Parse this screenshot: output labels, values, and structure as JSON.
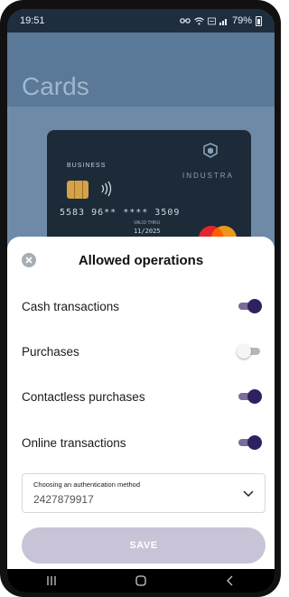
{
  "status_bar": {
    "time": "19:51",
    "battery": "79%",
    "icons": [
      "key-icon",
      "wifi-icon",
      "volte-icon",
      "signal-icon",
      "battery-icon"
    ]
  },
  "page": {
    "title": "Cards"
  },
  "card": {
    "type": "BUSINESS",
    "brand": "INDUSTRA",
    "number": "5583 96** **** 3509",
    "valid_label": "VALID THRU",
    "expiry": "11/2025",
    "network": "mastercard-icon"
  },
  "sheet": {
    "title": "Allowed operations",
    "operations": [
      {
        "label": "Cash transactions",
        "enabled": true
      },
      {
        "label": "Purchases",
        "enabled": false
      },
      {
        "label": "Contactless purchases",
        "enabled": true
      },
      {
        "label": "Online transactions",
        "enabled": true
      }
    ],
    "auth_select": {
      "label": "Choosing an authentication method",
      "value": "2427879917"
    },
    "save_label": "SAVE"
  },
  "colors": {
    "accent": "#2c2260",
    "toggle_track_on": "#7b6c98",
    "save_disabled": "#c9c3d8"
  }
}
